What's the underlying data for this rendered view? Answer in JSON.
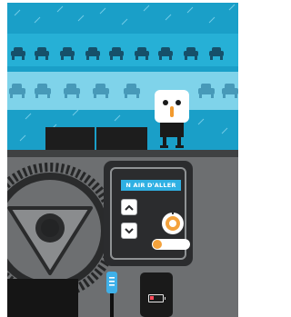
{
  "scene": {
    "panel": {
      "title": "N AIR D'ALLER"
    },
    "colors": {
      "sky": "#1a9fc8",
      "band_dark": "#26b0d6",
      "band_light": "#7fd3ea",
      "dashboard": "#6d6f71",
      "panel_bg": "#2b2c2e",
      "panel_title_bg": "#2fb0e3",
      "knob_accent": "#f4a23c",
      "usb_cable": "#3fb0e8",
      "battery_low": "#ff4b5c"
    },
    "icons": [
      "car-icon",
      "up-arrow-icon",
      "down-arrow-icon",
      "dial-knob-icon",
      "toggle-switch",
      "usb-plug-icon",
      "battery-icon",
      "steering-wheel"
    ]
  }
}
